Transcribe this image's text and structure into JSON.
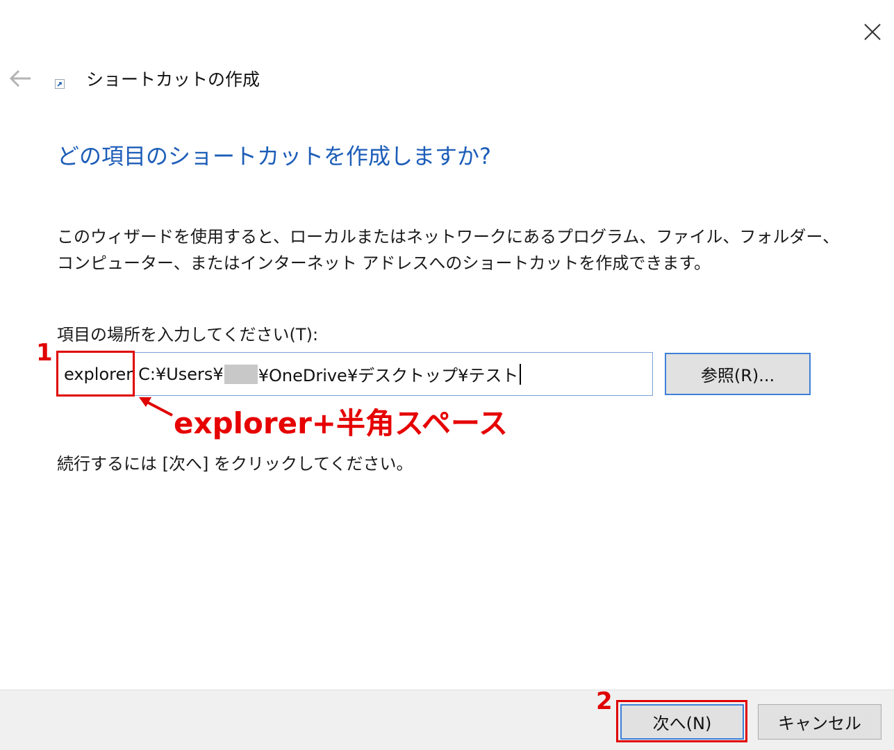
{
  "window": {
    "title": "ショートカットの作成"
  },
  "heading": "どの項目のショートカットを作成しますか?",
  "description": "このウィザードを使用すると、ローカルまたはネットワークにあるプログラム、ファイル、フォルダー、コンピューター、またはインターネット アドレスへのショートカットを作成できます。",
  "location_field": {
    "label": "項目の場所を入力してください(T):",
    "typed_prefix": "explorer",
    "path_start": "C:¥Users¥",
    "path_end": "¥OneDrive¥デスクトップ¥テスト"
  },
  "browse_button": "参照(R)...",
  "continue_hint": "続行するには [次へ] をクリックしてください。",
  "footer": {
    "next_button": "次へ(N)",
    "cancel_button": "キャンセル"
  },
  "annotations": {
    "step1_number": "1",
    "step1_text": "explorer+半角スペース",
    "step2_number": "2",
    "color": "#e00000"
  },
  "colors": {
    "heading": "#1c5db8",
    "focus_border": "#3d7fd8",
    "footer_bg": "#f0f0f0"
  },
  "icons": [
    "close-icon",
    "back-arrow-icon",
    "shortcut-icon",
    "annotation-arrow-icon"
  ]
}
